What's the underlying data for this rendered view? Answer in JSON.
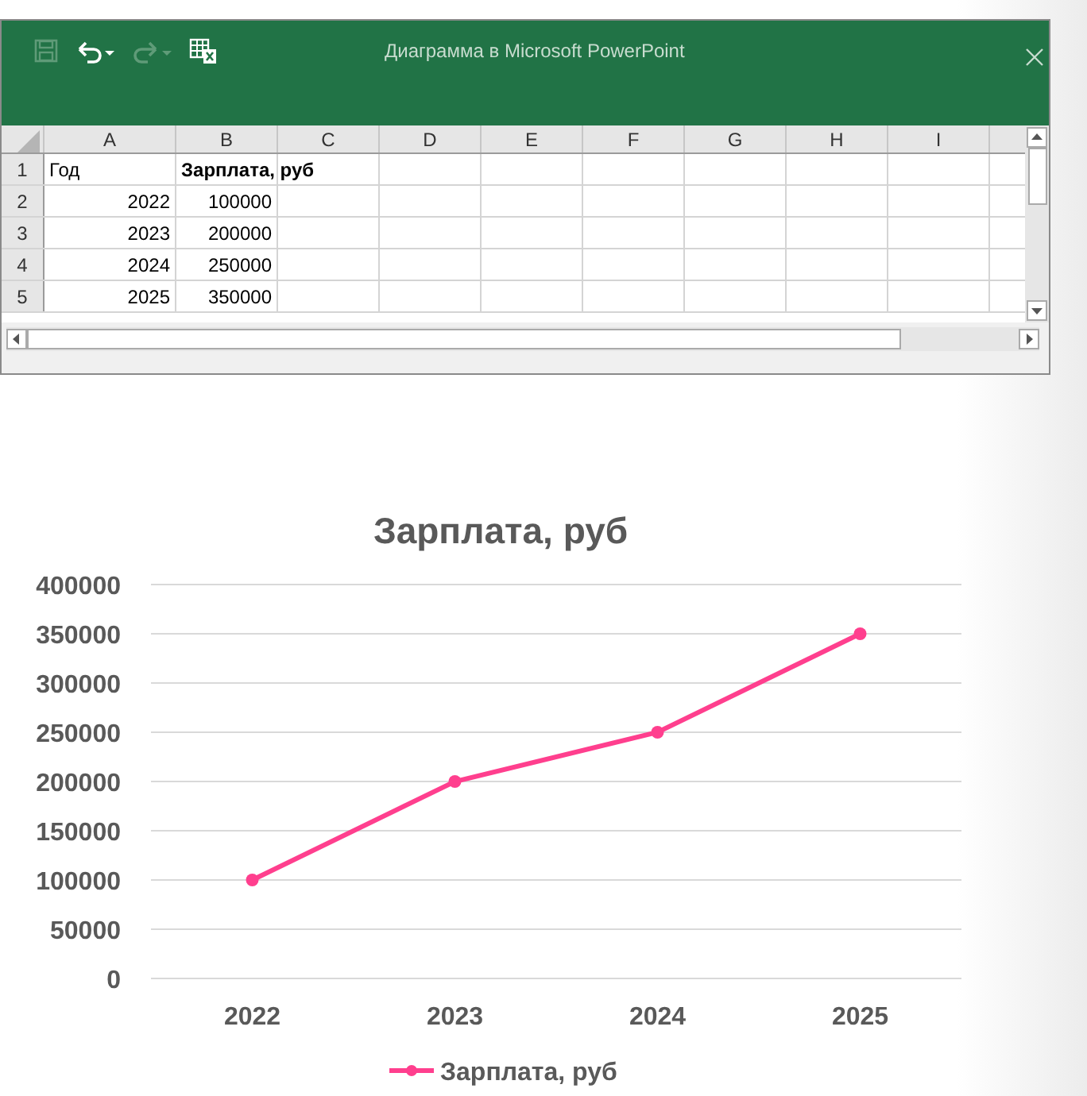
{
  "window": {
    "title": "Диаграмма в Microsoft PowerPoint"
  },
  "toolbar": [
    {
      "kind": "save",
      "disabled": true
    },
    {
      "kind": "undo",
      "disabled": false
    },
    {
      "kind": "redo",
      "disabled": true
    },
    {
      "kind": "sheet",
      "disabled": false
    }
  ],
  "sheet": {
    "columns": [
      "A",
      "B",
      "C",
      "D",
      "E",
      "F",
      "G",
      "H",
      "I"
    ],
    "rows": [
      {
        "number": "1",
        "cells": [
          {
            "text": "Год",
            "kind": "text",
            "bold": false
          },
          {
            "text": "Зарплата, руб",
            "kind": "text",
            "bold": true
          }
        ]
      },
      {
        "number": "2",
        "cells": [
          {
            "text": "2022",
            "kind": "number",
            "bold": false
          },
          {
            "text": "100000",
            "kind": "number",
            "bold": false
          }
        ]
      },
      {
        "number": "3",
        "cells": [
          {
            "text": "2023",
            "kind": "number",
            "bold": false
          },
          {
            "text": "200000",
            "kind": "number",
            "bold": false
          }
        ]
      },
      {
        "number": "4",
        "cells": [
          {
            "text": "2024",
            "kind": "number",
            "bold": false
          },
          {
            "text": "250000",
            "kind": "number",
            "bold": false
          }
        ]
      },
      {
        "number": "5",
        "cells": [
          {
            "text": "2025",
            "kind": "number",
            "bold": false
          },
          {
            "text": "350000",
            "kind": "number",
            "bold": false
          }
        ]
      }
    ]
  },
  "chart": {
    "chart_data": {
      "type": "line",
      "title": "Зарплата, руб",
      "categories": [
        "2022",
        "2023",
        "2024",
        "2025"
      ],
      "grid": true,
      "series": [
        {
          "name": "Зарплата, руб",
          "color": "#ff3f8e",
          "marker": "circle",
          "values": [
            100000,
            200000,
            250000,
            350000
          ]
        }
      ],
      "ylim": [
        0,
        400000
      ],
      "yticks": [
        0,
        50000,
        100000,
        150000,
        200000,
        250000,
        300000,
        350000,
        400000
      ]
    }
  }
}
